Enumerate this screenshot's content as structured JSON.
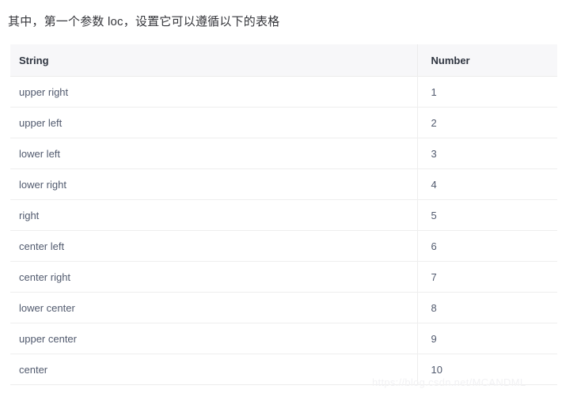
{
  "intro": {
    "text": "其中，第一个参数 loc，设置它可以遵循以下的表格"
  },
  "table": {
    "columns": [
      "String",
      "Number"
    ],
    "rows": [
      {
        "string": "upper right",
        "number": "1"
      },
      {
        "string": "upper left",
        "number": "2"
      },
      {
        "string": "lower left",
        "number": "3"
      },
      {
        "string": "lower right",
        "number": "4"
      },
      {
        "string": "right",
        "number": "5"
      },
      {
        "string": "center left",
        "number": "6"
      },
      {
        "string": "center right",
        "number": "7"
      },
      {
        "string": "lower center",
        "number": "8"
      },
      {
        "string": "upper center",
        "number": "9"
      },
      {
        "string": "center",
        "number": "10"
      }
    ]
  },
  "watermark": {
    "text": "https://blog.csdn.net/MCANDML"
  },
  "colors": {
    "page_background": "#ffffff",
    "header_background": "#f7f7f9",
    "header_text": "#2f3540",
    "body_text": "#515a6e",
    "intro_text": "#34353a",
    "row_divider": "#eeeeee",
    "watermark_text": "#f2f2f4"
  }
}
